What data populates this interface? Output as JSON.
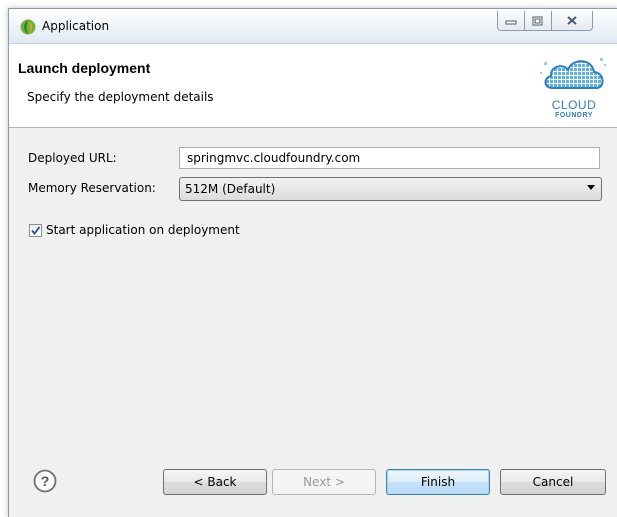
{
  "window": {
    "title": "Application",
    "controls": {
      "minimize": "—",
      "maximize": "▢",
      "close": "✕"
    }
  },
  "header": {
    "title": "Launch deployment",
    "subtitle": "Specify the deployment details",
    "logo": {
      "line1": "CLOUD",
      "line2": "FOUNDRY",
      "color": "#2f7fc1"
    }
  },
  "form": {
    "url_label": "Deployed URL:",
    "url_value": "springmvc.cloudfoundry.com",
    "memory_label": "Memory Reservation:",
    "memory_value": "512M (Default)",
    "start_checkbox_label": "Start application on deployment",
    "start_checked": true
  },
  "buttons": {
    "back": "< Back",
    "next": "Next >",
    "finish": "Finish",
    "cancel": "Cancel"
  },
  "icons": {
    "app": "spring-leaf-icon",
    "help": "help-icon"
  }
}
